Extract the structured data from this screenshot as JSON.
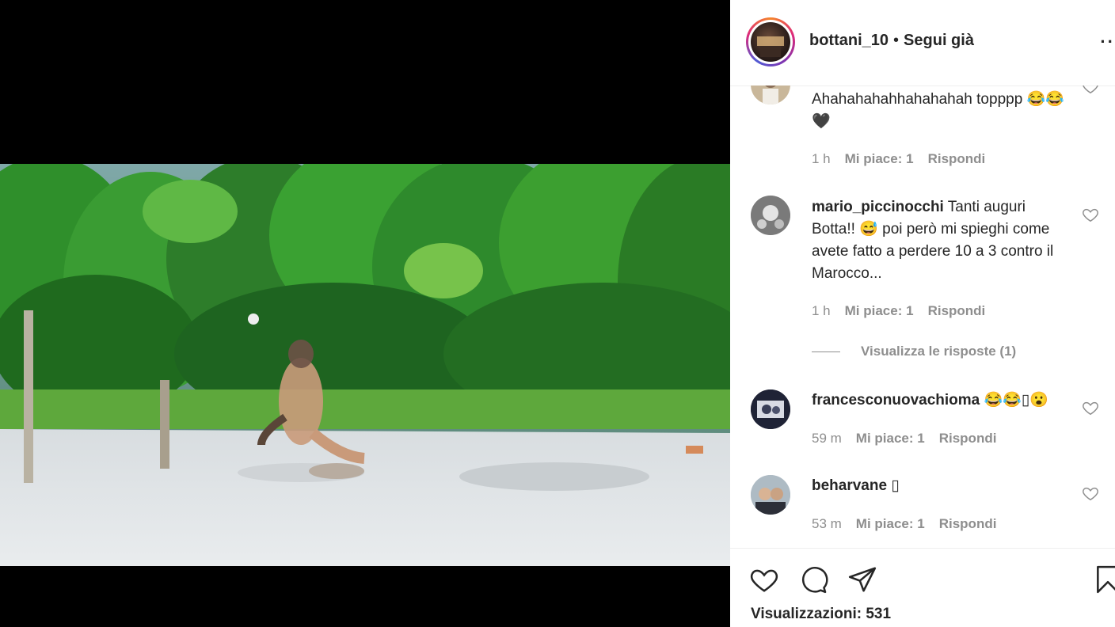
{
  "post": {
    "username": "bottani_10",
    "separator": "•",
    "follow_status": "Segui già",
    "more": "··"
  },
  "comments": [
    {
      "username": "",
      "text": "Ahahahahahhahahahah topppp 😂😂🖤",
      "time": "1 h",
      "likes": "Mi piace: 1",
      "reply": "Rispondi"
    },
    {
      "username": "mario_piccinocchi",
      "text": "Tanti auguri Botta!! 😅 poi però mi spieghi come avete fatto a perdere 10 a 3 contro il Marocco...",
      "time": "1 h",
      "likes": "Mi piace: 1",
      "reply": "Rispondi",
      "view_replies": "Visualizza le risposte (1)"
    },
    {
      "username": "francesconuovachioma",
      "text": "😂😂▯😮",
      "time": "59 m",
      "likes": "Mi piace: 1",
      "reply": "Rispondi"
    },
    {
      "username": "beharvane",
      "text": "▯",
      "time": "53 m",
      "likes": "Mi piace: 1",
      "reply": "Rispondi"
    }
  ],
  "footer": {
    "views": "Visualizzazioni: 531"
  },
  "icons": {
    "like": "heart-icon",
    "comment": "comment-icon",
    "share": "paper-plane-icon",
    "save": "bookmark-icon"
  }
}
